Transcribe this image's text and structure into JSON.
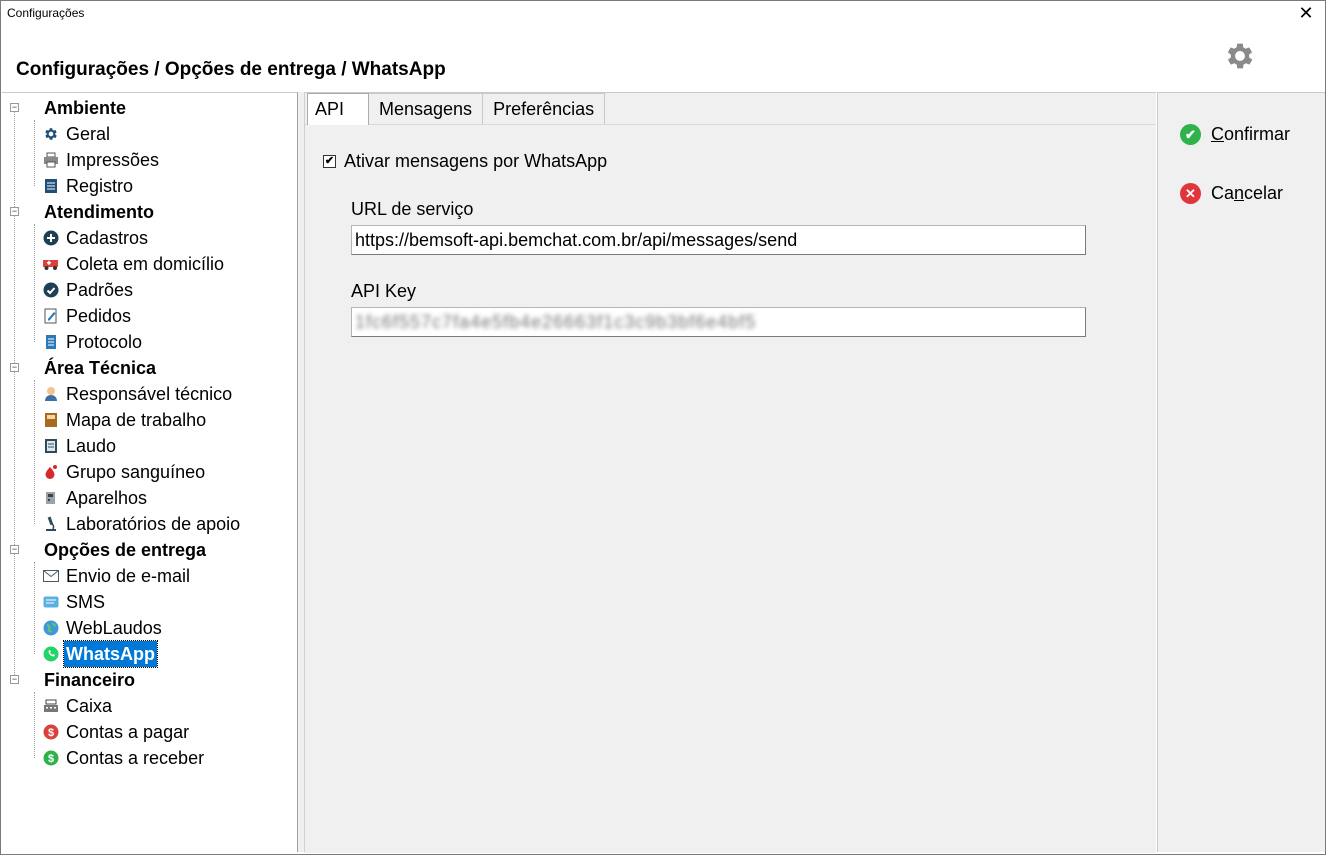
{
  "window": {
    "title": "Configurações",
    "close_glyph": "✕"
  },
  "header": {
    "breadcrumb": "Configurações / Opções de entrega / WhatsApp",
    "settings_icon": "gear-icon"
  },
  "tree": {
    "groups": [
      {
        "label": "Ambiente",
        "items": [
          {
            "label": "Geral",
            "icon": "gear-icon"
          },
          {
            "label": "Impressões",
            "icon": "printer-icon"
          },
          {
            "label": "Registro",
            "icon": "document-icon"
          }
        ]
      },
      {
        "label": "Atendimento",
        "items": [
          {
            "label": "Cadastros",
            "icon": "plus-circle-icon"
          },
          {
            "label": "Coleta em domicílio",
            "icon": "ambulance-icon"
          },
          {
            "label": "Padrões",
            "icon": "check-circle-icon"
          },
          {
            "label": "Pedidos",
            "icon": "edit-icon"
          },
          {
            "label": "Protocolo",
            "icon": "file-icon"
          }
        ]
      },
      {
        "label": "Área Técnica",
        "items": [
          {
            "label": "Responsável técnico",
            "icon": "person-icon"
          },
          {
            "label": "Mapa de trabalho",
            "icon": "book-icon"
          },
          {
            "label": "Laudo",
            "icon": "report-icon"
          },
          {
            "label": "Grupo sanguíneo",
            "icon": "blood-drop-icon"
          },
          {
            "label": "Aparelhos",
            "icon": "device-icon"
          },
          {
            "label": "Laboratórios de apoio",
            "icon": "microscope-icon"
          }
        ]
      },
      {
        "label": "Opções de entrega",
        "items": [
          {
            "label": "Envio de e-mail",
            "icon": "envelope-icon"
          },
          {
            "label": "SMS",
            "icon": "sms-icon"
          },
          {
            "label": "WebLaudos",
            "icon": "globe-icon"
          },
          {
            "label": "WhatsApp",
            "icon": "whatsapp-icon",
            "selected": true
          }
        ]
      },
      {
        "label": "Financeiro",
        "items": [
          {
            "label": "Caixa",
            "icon": "cash-register-icon"
          },
          {
            "label": "Contas a pagar",
            "icon": "dollar-red-icon"
          },
          {
            "label": "Contas a receber",
            "icon": "dollar-green-icon"
          }
        ]
      }
    ]
  },
  "tabs": [
    {
      "label": "API",
      "active": true
    },
    {
      "label": "Mensagens",
      "active": false
    },
    {
      "label": "Preferências",
      "active": false
    }
  ],
  "api": {
    "enable_checkbox": {
      "label": "Ativar mensagens por WhatsApp",
      "checked": true,
      "mark": "✔"
    },
    "url": {
      "label": "URL de serviço",
      "value": "https://bemsoft-api.bemchat.com.br/api/messages/send"
    },
    "key": {
      "label": "API Key",
      "value": "1fc6f557c7fa4e5fb4e26663f1c3c9b3bf6e4bf5"
    }
  },
  "actions": {
    "confirm": {
      "label": "Confirmar",
      "mnemonic": "C",
      "rest": "onfirmar",
      "color": "#2eb24b",
      "glyph": "✔"
    },
    "cancel": {
      "label": "Cancelar",
      "prefix": "Ca",
      "mnemonic": "n",
      "rest": "celar",
      "color": "#e0353b",
      "glyph": "✕"
    }
  },
  "colors": {
    "selection": "#0078d7",
    "panel": "#f0f0f0"
  }
}
